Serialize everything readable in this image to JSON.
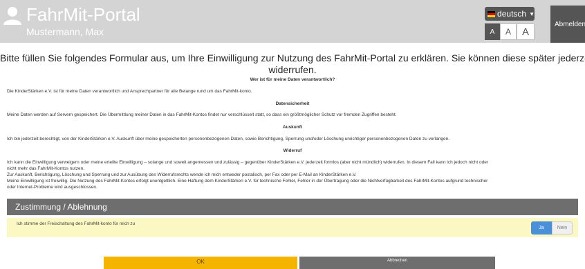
{
  "header": {
    "app_title": "FahrMit-Portal",
    "user_name": "Mustermann, Max",
    "language": "deutsch",
    "font_small": "A",
    "font_medium": "A",
    "font_large": "A",
    "logout": "Abmelden"
  },
  "intro": {
    "line1": "Bitte füllen Sie folgendes Formular aus, um Ihre Einwilligung zur Nutzung des FahrMit-Portal zu erklären. Sie können diese später jederze",
    "line2": "widerrufen."
  },
  "terms": {
    "heading_responsible": "Wer ist für meine Daten verantwortlich?",
    "text_responsible": "Die KinderStärken e.V. ist für meine Daten verantwortlich und Ansprechpartner für alle Belange rund um das FahrMit-konto.",
    "heading_security": "Datensicherheit",
    "text_security": "Meine Daten werden auf Servern gespeichert. Die Übermittlung meiner Daten in das FahrMit-Kontos findet nur verschlüsselt statt, so dass ein größtmöglicher Schutz vor fremden Zugriffen besteht.",
    "heading_info": "Auskunft",
    "text_info": "Ich bin jederzeit berechtigt, von der KinderStärken e.V. Auskunft über meine gespeicherten personenbezogenen Daten, sowie Berichtigung, Sperrung und/oder Löschung unrichtiger personenbezogenen Daten zu verlangen.",
    "heading_revoke": "Widerruf",
    "text_revoke_1": "Ich kann die Einwilligung verweigern oder meine erteilte Einwilligung – solange und soweit angemessen und zulässig – gegenüber KinderStärken e.V. jederzeit formlos (aber nicht mündlich) widerrufen. In diesem Fall kann ich jedoch nicht oder",
    "text_revoke_2": "nicht mehr das FahrMit-Kontos nutzen.",
    "text_revoke_3": "Zur Auskunft, Berichtigung, Löschung und Sperrung und zur Ausübung des Widerrufsrechts wende ich mich entweder postalisch, per Fax oder per E-Mail an KinderStärken e.V.",
    "text_revoke_4": "Meine Einwilligung ist freiwillig. Die Nutzung des FahrMit-Kontos erfolgt unentgeltlich. Eine Haftung dem KinderStärken e.V. für technische Fehler, Fehler in der Übertragung oder die Nichtverfügbarkeit des FahrMit-Kontos aufgrund technischer",
    "text_revoke_5": "oder Internet-Probleme wird ausgeschlossen."
  },
  "consent": {
    "section_title": "Zustimmung / Ablehnung",
    "question": "Ich stimme der Freischaltung des FahrMit-konto für mich zu",
    "yes": "Ja",
    "no": "Nein",
    "selected": "Ja"
  },
  "actions": {
    "ok": "OK",
    "cancel": "Abbrechen"
  },
  "colors": {
    "header_bg": "#d4d4d4",
    "dark_gray": "#555555",
    "consent_bar": "#6e6e6e",
    "consent_row_bg": "#fbf8c3",
    "selected_blue": "#4a90d9",
    "ok_yellow": "#f5b400"
  },
  "icons": {
    "user": "user-icon",
    "caret": "caret-down-icon",
    "flag": "german-flag-icon"
  }
}
